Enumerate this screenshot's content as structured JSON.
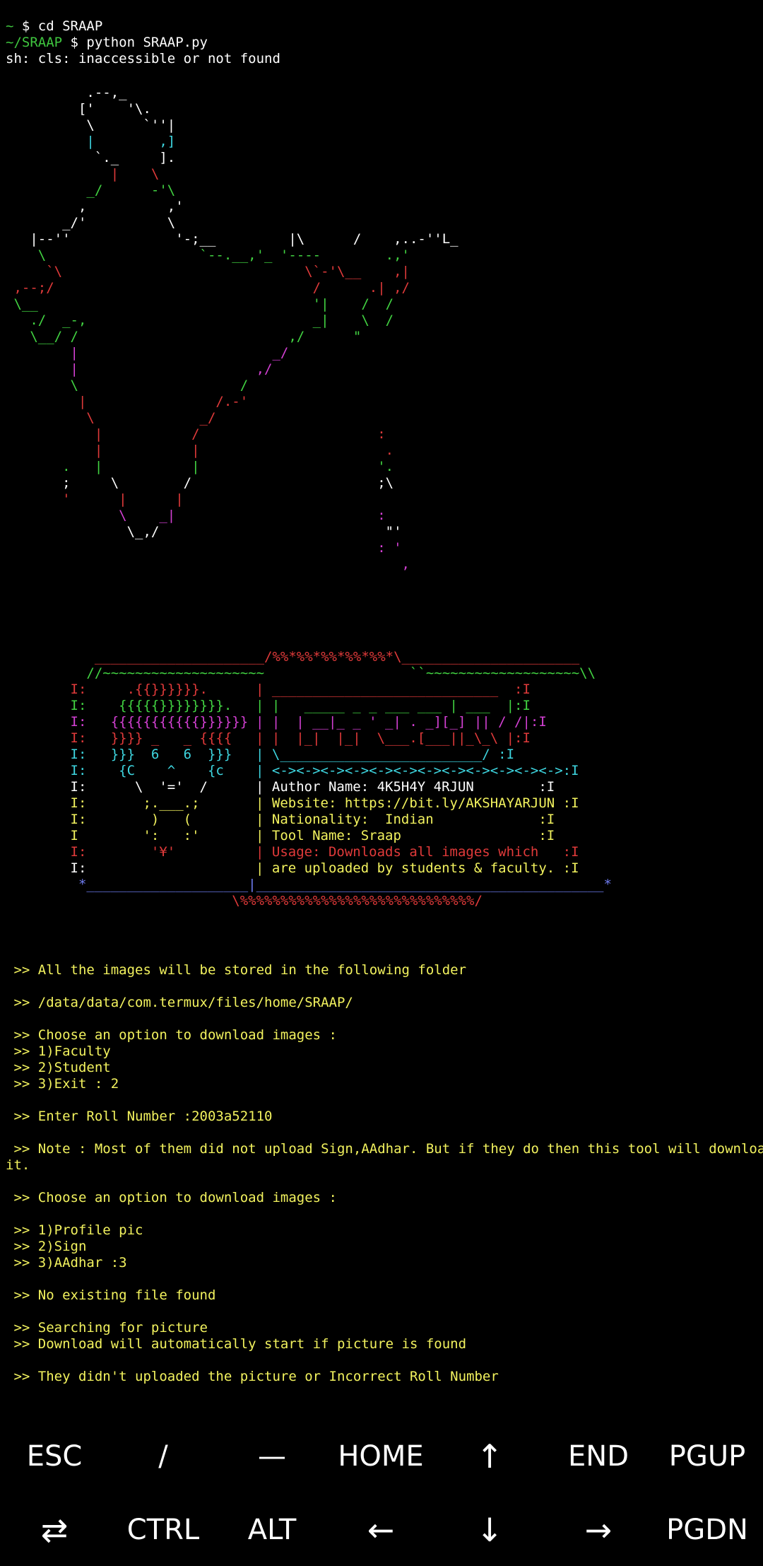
{
  "terminal": {
    "commands": [
      {
        "prompt": "~",
        "text": " $ cd SRAAP"
      },
      {
        "prompt": "~/SRAAP",
        "text": " $ python SRAAP.py"
      }
    ],
    "error_line": "sh: cls: inaccessible or not found",
    "india_map": [
      "          .--,_",
      "         ['    '\\.",
      "          \\      `''|",
      "          |        ,]",
      "           `._     ].",
      "             |    \\",
      "          _/      -'\\",
      "         ,          ,'",
      "       _/'          \\",
      "   |--''             '-;__         |\\      /    ,..-''L_",
      "    \\                   `--.__,'_ '----        .,'",
      "     `\\                              \\`-'\\__    ,|",
      " ,--;/                                /      .| ,/",
      " \\__                                  '|    /  /",
      "   ./  _-,                            _|    \\  /",
      "   \\__/ /                          ,/      \"",
      "        |                        _/",
      "        |                      ,/",
      "        \\                    /",
      "         |                /.-'",
      "          \\             _/",
      "           |           /                      :",
      "           |           |                       .",
      "       .   |           |                      '.",
      "       ;     \\        /                       ;\\",
      "       '      |      |",
      "              \\    _|                         :",
      "               \\_,/                            \"'",
      "                                              : '",
      "                                                 ,"
    ],
    "banner": {
      "top": "           _____________________/%%*%%*%%*%%*%%*\\______________________",
      "top_sub": "          //~~~~~~~~~~~~~~~~~~~~                  ``~~~~~~~~~~~~~~~~~~~\\\\",
      "rows": [
        {
          "left": "        I:     .{{}}}}}}.    ",
          "right": "| ____________________________  :I",
          "lc": "red",
          "rc": "red"
        },
        {
          "left": "        I:    {{{{{}}}}}}}}.  ",
          "right": "| |   _____ _ _ ___ ___ | ___  |:I",
          "lc": "lime",
          "rc": "lime"
        },
        {
          "left": "        I:   {{{{{{{{{{{}}}}}} ",
          "right": "| |  | __|_ _ ' _| . _][_] || / /|:I",
          "lc": "magenta",
          "rc": "magenta"
        },
        {
          "left": "        I:   }}}} _   _ {{{{ ",
          "right": "| |  |_|  |_|  \\___.[___||_\\_\\ |:I",
          "lc": "red",
          "rc": "red"
        },
        {
          "left": "        I:   }}}  6   6  }}}  ",
          "right": "| \\_________________________/ :I",
          "lc": "cyan",
          "rc": "cyan"
        },
        {
          "left": "        I:    {C    ^    {c   ",
          "right": "| <-><-><-><-><-><-><-><-><-><-><-><->:I",
          "lc": "cyan",
          "rc": "cyan"
        },
        {
          "left": "        I:      \\  '='  /     ",
          "right": "| Author Name: 4K5H4Y 4RJUN        :I",
          "lc": "white",
          "rc": "white"
        },
        {
          "left": "        I:       ;.___.;      ",
          "right": "| Website: https://bit.ly/AKSHAYARJUN :I",
          "lc": "yellow",
          "rc": "yellow"
        },
        {
          "left": "        I:        )   (       ",
          "right": "| Nationality:  Indian             :I",
          "lc": "yellow",
          "rc": "yellow"
        },
        {
          "left": "        I        ':   :'      ",
          "right": "| Tool Name: Sraap                 :I",
          "lc": "yellow",
          "rc": "yellow"
        },
        {
          "left": "        I:        '¥'        ",
          "right": "| Usage: Downloads all images which   :I",
          "lc": "red",
          "rc": "red"
        },
        {
          "left": "        I:                    ",
          "right": "| are uploaded by students & faculty. :I",
          "lc": "white",
          "rc": "yellow"
        }
      ],
      "bottom": "         *____________________|___________________________________________*",
      "bottom_sub": "                            \\%%%%%%%%%%%%%%%%%%%%%%%%%%%%%/"
    },
    "output_lines": [
      {
        "text": " >> All the images will be stored in the following folder",
        "gap_before": 0
      },
      {
        "text": " >> /data/data/com.termux/files/home/SRAAP/",
        "gap_before": 1
      },
      {
        "text": " >> Choose an option to download images :",
        "gap_before": 1
      },
      {
        "text": " >> 1)Faculty",
        "gap_before": 0
      },
      {
        "text": " >> 2)Student",
        "gap_before": 0
      },
      {
        "text": " >> 3)Exit : 2",
        "gap_before": 0
      },
      {
        "text": " >> Enter Roll Number :2003a52110",
        "gap_before": 1
      },
      {
        "text": " >> Note : Most of them did not upload Sign,AAdhar. But if they do then this tool will download",
        "gap_before": 1
      },
      {
        "text": "it.",
        "gap_before": 0
      },
      {
        "text": " >> Choose an option to download images :",
        "gap_before": 1
      },
      {
        "text": " >> 1)Profile pic",
        "gap_before": 1
      },
      {
        "text": " >> 2)Sign",
        "gap_before": 0
      },
      {
        "text": " >> 3)AAdhar :3",
        "gap_before": 0
      },
      {
        "text": " >> No existing file found",
        "gap_before": 1
      },
      {
        "text": " >> Searching for picture",
        "gap_before": 1
      },
      {
        "text": " >> Download will automatically start if picture is found",
        "gap_before": 0
      },
      {
        "text": " >> They didn't uploaded the picture or Incorrect Roll Number",
        "gap_before": 1
      }
    ]
  },
  "extra_keys": {
    "row1": [
      "ESC",
      "/",
      "—",
      "HOME",
      "↑",
      "END",
      "PGUP"
    ],
    "row2": [
      "⇄",
      "CTRL",
      "ALT",
      "←",
      "↓",
      "→",
      "PGDN"
    ]
  },
  "colors": {
    "background": "#000000",
    "prompt": "#3fc63f",
    "output": "#f2f25e",
    "text": "#ffffff"
  }
}
